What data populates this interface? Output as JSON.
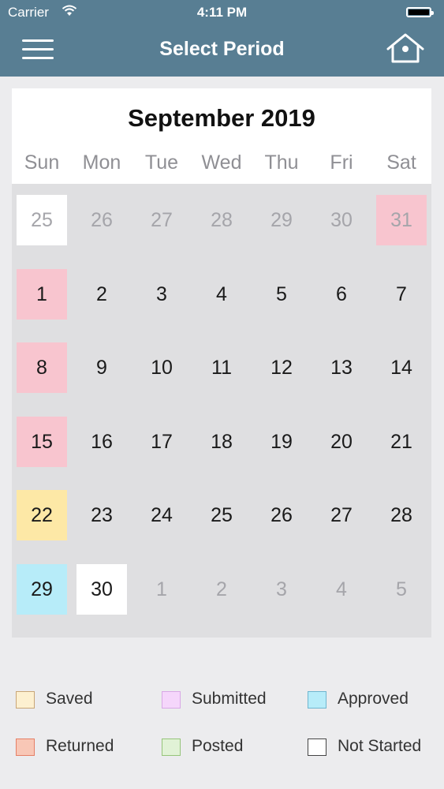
{
  "status_bar": {
    "carrier": "Carrier",
    "time": "4:11 PM"
  },
  "nav": {
    "title": "Select Period",
    "menu_icon": "hamburger-menu-icon",
    "home_icon": "home-icon"
  },
  "calendar": {
    "month_title": "September 2019",
    "weekdays": [
      "Sun",
      "Mon",
      "Tue",
      "Wed",
      "Thu",
      "Fri",
      "Sat"
    ],
    "weeks": [
      [
        {
          "day": "25",
          "other": true,
          "status": "not-started-selected"
        },
        {
          "day": "26",
          "other": true
        },
        {
          "day": "27",
          "other": true
        },
        {
          "day": "28",
          "other": true
        },
        {
          "day": "29",
          "other": true
        },
        {
          "day": "30",
          "other": true
        },
        {
          "day": "31",
          "other": true,
          "status": "returned"
        }
      ],
      [
        {
          "day": "1",
          "status": "returned"
        },
        {
          "day": "2"
        },
        {
          "day": "3"
        },
        {
          "day": "4"
        },
        {
          "day": "5"
        },
        {
          "day": "6"
        },
        {
          "day": "7"
        }
      ],
      [
        {
          "day": "8",
          "status": "returned"
        },
        {
          "day": "9"
        },
        {
          "day": "10"
        },
        {
          "day": "11"
        },
        {
          "day": "12"
        },
        {
          "day": "13"
        },
        {
          "day": "14"
        }
      ],
      [
        {
          "day": "15",
          "status": "returned"
        },
        {
          "day": "16"
        },
        {
          "day": "17"
        },
        {
          "day": "18"
        },
        {
          "day": "19"
        },
        {
          "day": "20"
        },
        {
          "day": "21"
        }
      ],
      [
        {
          "day": "22",
          "status": "saved"
        },
        {
          "day": "23"
        },
        {
          "day": "24"
        },
        {
          "day": "25"
        },
        {
          "day": "26"
        },
        {
          "day": "27"
        },
        {
          "day": "28"
        }
      ],
      [
        {
          "day": "29",
          "status": "approved"
        },
        {
          "day": "30",
          "status": "not-started"
        },
        {
          "day": "1",
          "other": true
        },
        {
          "day": "2",
          "other": true
        },
        {
          "day": "3",
          "other": true
        },
        {
          "day": "4",
          "other": true
        },
        {
          "day": "5",
          "other": true
        }
      ]
    ]
  },
  "legend": [
    {
      "label": "Saved",
      "fill": "#fdf0d0",
      "border": "#c9a677"
    },
    {
      "label": "Submitted",
      "fill": "#f5d6fb",
      "border": "#d8a8e6"
    },
    {
      "label": "Approved",
      "fill": "#b7ecf9",
      "border": "#6fb6cf"
    },
    {
      "label": "Returned",
      "fill": "#f8c7b6",
      "border": "#e57f66"
    },
    {
      "label": "Posted",
      "fill": "#e1f2d6",
      "border": "#96c47a"
    },
    {
      "label": "Not Started",
      "fill": "#ffffff",
      "border": "#444444"
    }
  ],
  "colors": {
    "nav_bar": "#587e93",
    "returned_cell": "#f8c5cf",
    "saved_cell": "#fde8a6",
    "approved_cell": "#b7ecf9"
  }
}
